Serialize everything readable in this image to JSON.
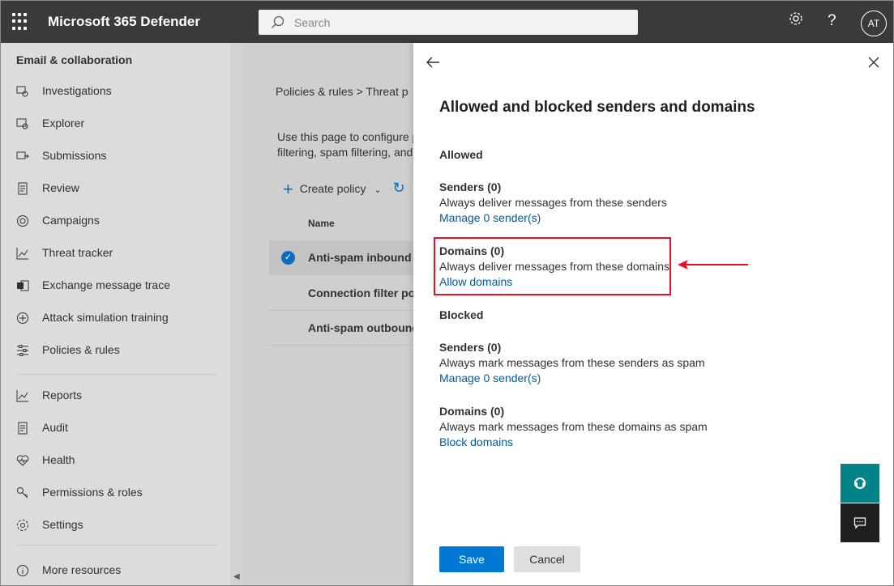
{
  "topbar": {
    "app_title": "Microsoft 365 Defender",
    "search_placeholder": "Search",
    "avatar_initials": "AT",
    "help_glyph": "?"
  },
  "sidebar": {
    "section_title": "Email & collaboration",
    "items": [
      {
        "label": "Investigations",
        "icon": "investigations-icon"
      },
      {
        "label": "Explorer",
        "icon": "explorer-icon"
      },
      {
        "label": "Submissions",
        "icon": "submissions-icon"
      },
      {
        "label": "Review",
        "icon": "review-icon"
      },
      {
        "label": "Campaigns",
        "icon": "campaigns-icon"
      },
      {
        "label": "Threat tracker",
        "icon": "threat-tracker-icon"
      },
      {
        "label": "Exchange message trace",
        "icon": "exchange-icon"
      },
      {
        "label": "Attack simulation training",
        "icon": "attack-simulation-icon"
      },
      {
        "label": "Policies & rules",
        "icon": "policies-icon"
      }
    ],
    "items2": [
      {
        "label": "Reports",
        "icon": "reports-icon"
      },
      {
        "label": "Audit",
        "icon": "audit-icon"
      },
      {
        "label": "Health",
        "icon": "health-icon"
      },
      {
        "label": "Permissions & roles",
        "icon": "permissions-icon"
      },
      {
        "label": "Settings",
        "icon": "settings-icon"
      }
    ],
    "more_resources": "More resources"
  },
  "main": {
    "breadcrumb": "Policies & rules  >  Threat p",
    "description_line1": "Use this page to configure p",
    "description_line2": "filtering, spam filtering, and",
    "create_policy": "Create policy",
    "column_name": "Name",
    "rows": [
      {
        "label": "Anti-spam inbound p",
        "selected": true
      },
      {
        "label": "Connection filter pol",
        "selected": false
      },
      {
        "label": "Anti-spam outbound",
        "selected": false
      }
    ]
  },
  "panel": {
    "title": "Allowed and blocked senders and domains",
    "allowed_heading": "Allowed",
    "allowed_senders": {
      "title": "Senders (0)",
      "desc": "Always deliver messages from these senders",
      "link": "Manage 0 sender(s)"
    },
    "allowed_domains": {
      "title": "Domains (0)",
      "desc": "Always deliver messages from these domains",
      "link": "Allow domains"
    },
    "blocked_heading": "Blocked",
    "blocked_senders": {
      "title": "Senders (0)",
      "desc": "Always mark messages from these senders as spam",
      "link": "Manage 0 sender(s)"
    },
    "blocked_domains": {
      "title": "Domains (0)",
      "desc": "Always mark messages from these domains as spam",
      "link": "Block domains"
    },
    "save_label": "Save",
    "cancel_label": "Cancel"
  },
  "colors": {
    "topbar": "#3b3a39",
    "primary": "#0078d4",
    "link": "#005a9e",
    "highlight": "#e81123",
    "help_fab": "#038387"
  }
}
